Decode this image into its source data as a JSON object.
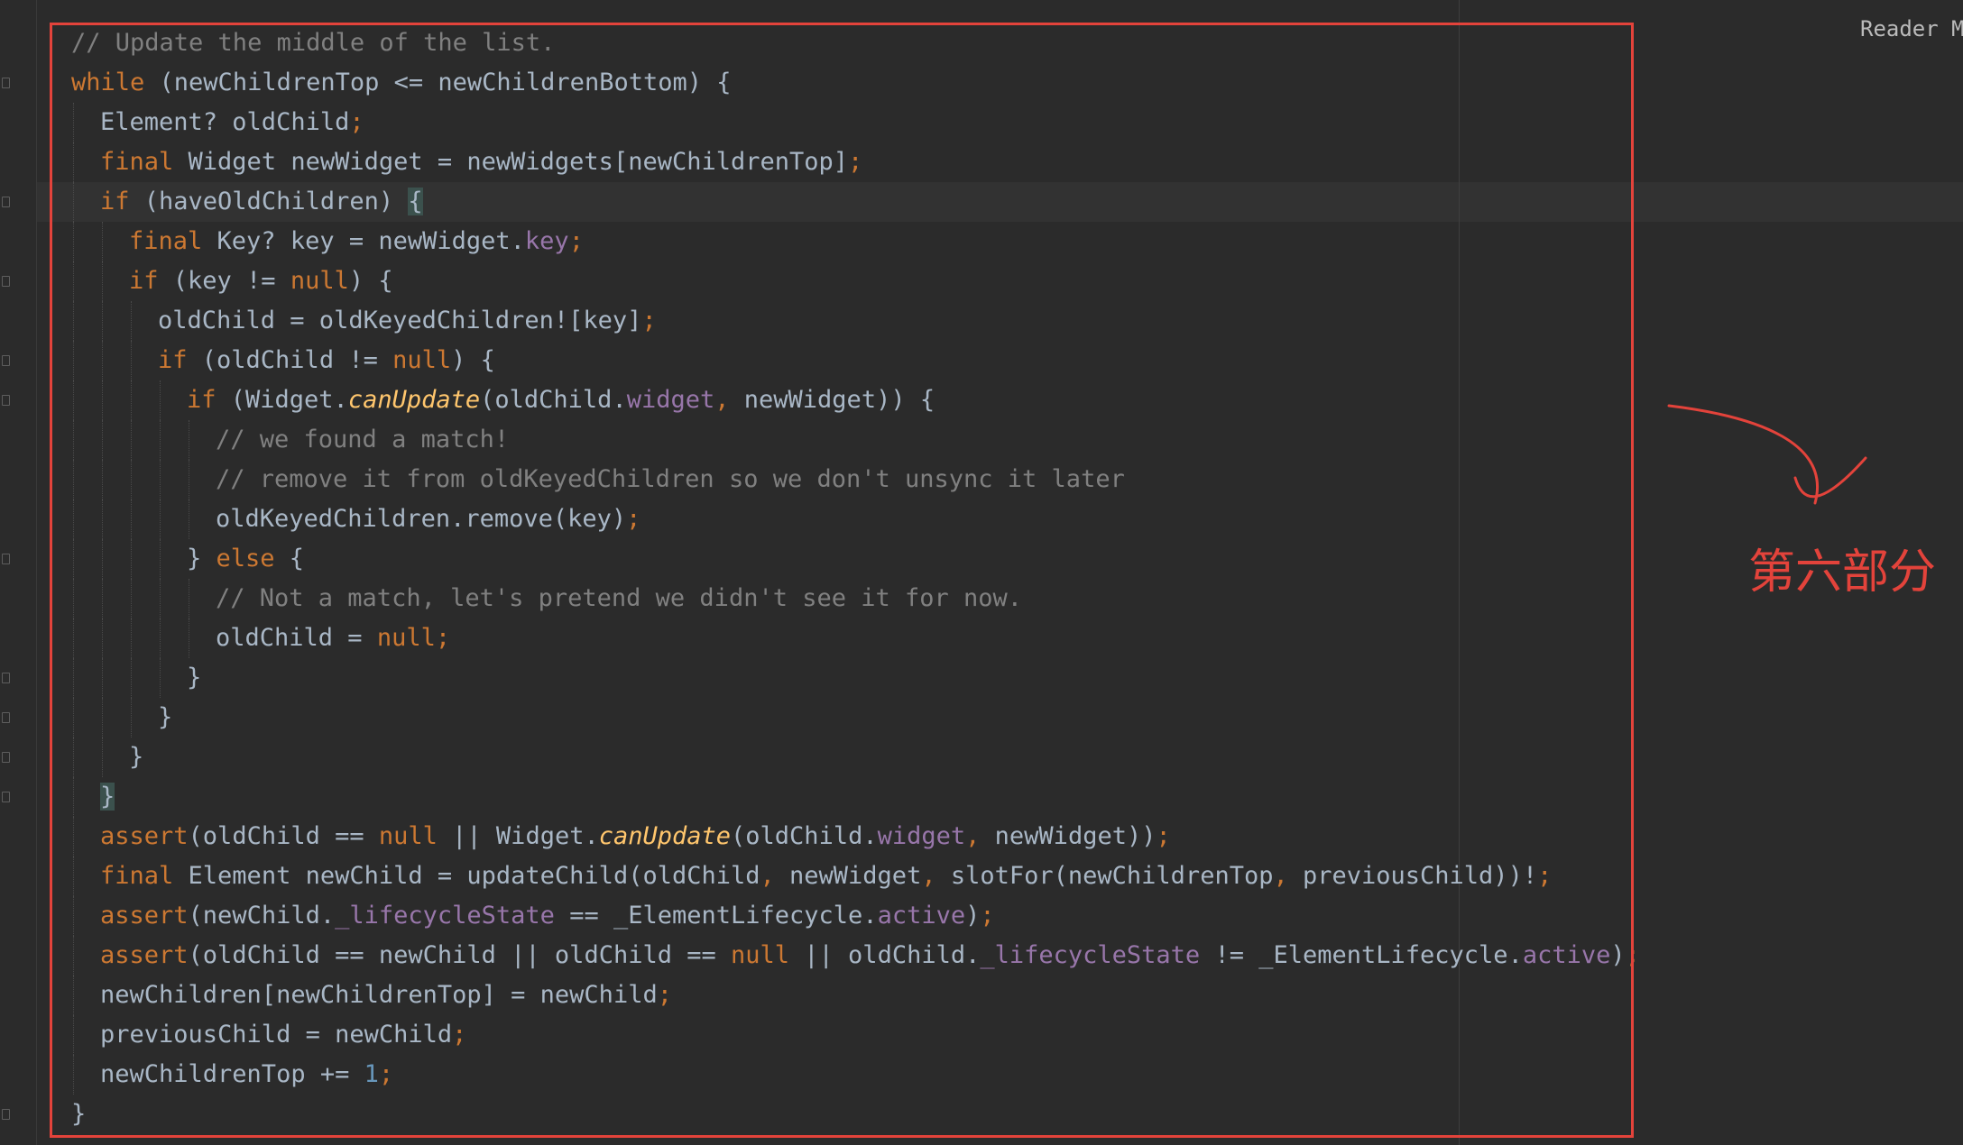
{
  "editor": {
    "reader_mode_label": "Reader M",
    "selection_color": "#e3433b",
    "theme": {
      "background": "#2b2b2b",
      "text": "#a9b7c6",
      "keyword": "#cc7832",
      "number": "#6897bb",
      "comment": "#808080",
      "field": "#9876aa",
      "method": "#ffc66d"
    }
  },
  "annotation": {
    "label": "第六部分",
    "arrow_icon": "curved-arrow-icon"
  },
  "code": {
    "lines": [
      {
        "indent": 0,
        "tokens": [
          {
            "t": "// Update the middle of the list.",
            "c": "cmt"
          }
        ]
      },
      {
        "indent": 0,
        "tokens": [
          {
            "t": "while",
            "c": "kw"
          },
          {
            "t": " (newChildrenTop <= newChildrenBottom) {"
          }
        ]
      },
      {
        "indent": 1,
        "tokens": [
          {
            "t": "Element? oldChild"
          },
          {
            "t": ";",
            "c": "kw"
          }
        ]
      },
      {
        "indent": 1,
        "tokens": [
          {
            "t": "final",
            "c": "kw"
          },
          {
            "t": " Widget newWidget = newWidgets[newChildrenTop]"
          },
          {
            "t": ";",
            "c": "kw"
          }
        ]
      },
      {
        "indent": 1,
        "tokens": [
          {
            "t": "if",
            "c": "kw"
          },
          {
            "t": " (haveOldChildren) "
          },
          {
            "t": "{",
            "c": "brc"
          }
        ]
      },
      {
        "indent": 2,
        "tokens": [
          {
            "t": "final",
            "c": "kw"
          },
          {
            "t": " Key? key = newWidget."
          },
          {
            "t": "key",
            "c": "fld"
          },
          {
            "t": ";",
            "c": "kw"
          }
        ]
      },
      {
        "indent": 2,
        "tokens": [
          {
            "t": "if",
            "c": "kw"
          },
          {
            "t": " (key != "
          },
          {
            "t": "null",
            "c": "kw"
          },
          {
            "t": ") {"
          }
        ]
      },
      {
        "indent": 3,
        "tokens": [
          {
            "t": "oldChild = oldKeyedChildren![key]"
          },
          {
            "t": ";",
            "c": "kw"
          }
        ]
      },
      {
        "indent": 3,
        "tokens": [
          {
            "t": "if",
            "c": "kw"
          },
          {
            "t": " (oldChild != "
          },
          {
            "t": "null",
            "c": "kw"
          },
          {
            "t": ") {"
          }
        ]
      },
      {
        "indent": 4,
        "tokens": [
          {
            "t": "if",
            "c": "kw"
          },
          {
            "t": " (Widget."
          },
          {
            "t": "canUpdate",
            "c": "mth"
          },
          {
            "t": "(oldChild."
          },
          {
            "t": "widget",
            "c": "fld"
          },
          {
            "t": ",",
            "c": "kw"
          },
          {
            "t": " newWidget)) {"
          }
        ]
      },
      {
        "indent": 5,
        "tokens": [
          {
            "t": "// we found a match!",
            "c": "cmt"
          }
        ]
      },
      {
        "indent": 5,
        "tokens": [
          {
            "t": "// remove it from oldKeyedChildren so we don't unsync it later",
            "c": "cmt"
          }
        ]
      },
      {
        "indent": 5,
        "tokens": [
          {
            "t": "oldKeyedChildren.remove(key)"
          },
          {
            "t": ";",
            "c": "kw"
          }
        ]
      },
      {
        "indent": 4,
        "tokens": [
          {
            "t": "} "
          },
          {
            "t": "else",
            "c": "kw"
          },
          {
            "t": " {"
          }
        ]
      },
      {
        "indent": 5,
        "tokens": [
          {
            "t": "// Not a match, let's pretend we didn't see it for now.",
            "c": "cmt"
          }
        ]
      },
      {
        "indent": 5,
        "tokens": [
          {
            "t": "oldChild = "
          },
          {
            "t": "null",
            "c": "kw"
          },
          {
            "t": ";",
            "c": "kw"
          }
        ]
      },
      {
        "indent": 4,
        "tokens": [
          {
            "t": "}"
          }
        ]
      },
      {
        "indent": 3,
        "tokens": [
          {
            "t": "}"
          }
        ]
      },
      {
        "indent": 2,
        "tokens": [
          {
            "t": "}"
          }
        ]
      },
      {
        "indent": 1,
        "tokens": [
          {
            "t": "}",
            "c": "brc"
          }
        ]
      },
      {
        "indent": 1,
        "tokens": [
          {
            "t": "assert",
            "c": "kw"
          },
          {
            "t": "(oldChild == "
          },
          {
            "t": "null",
            "c": "kw"
          },
          {
            "t": " || Widget."
          },
          {
            "t": "canUpdate",
            "c": "mth"
          },
          {
            "t": "(oldChild."
          },
          {
            "t": "widget",
            "c": "fld"
          },
          {
            "t": ",",
            "c": "kw"
          },
          {
            "t": " newWidget))"
          },
          {
            "t": ";",
            "c": "kw"
          }
        ]
      },
      {
        "indent": 1,
        "tokens": [
          {
            "t": "final",
            "c": "kw"
          },
          {
            "t": " Element newChild = updateChild(oldChild"
          },
          {
            "t": ",",
            "c": "kw"
          },
          {
            "t": " newWidget"
          },
          {
            "t": ",",
            "c": "kw"
          },
          {
            "t": " slotFor(newChildrenTop"
          },
          {
            "t": ",",
            "c": "kw"
          },
          {
            "t": " previousChild))!"
          },
          {
            "t": ";",
            "c": "kw"
          }
        ]
      },
      {
        "indent": 1,
        "tokens": [
          {
            "t": "assert",
            "c": "kw"
          },
          {
            "t": "(newChild."
          },
          {
            "t": "_lifecycleState",
            "c": "fld"
          },
          {
            "t": " == _ElementLifecycle."
          },
          {
            "t": "active",
            "c": "fld"
          },
          {
            "t": ")"
          },
          {
            "t": ";",
            "c": "kw"
          }
        ]
      },
      {
        "indent": 1,
        "tokens": [
          {
            "t": "assert",
            "c": "kw"
          },
          {
            "t": "(oldChild == newChild || oldChild == "
          },
          {
            "t": "null",
            "c": "kw"
          },
          {
            "t": " || oldChild."
          },
          {
            "t": "_lifecycleState",
            "c": "fld"
          },
          {
            "t": " != _ElementLifecycle."
          },
          {
            "t": "active",
            "c": "fld"
          },
          {
            "t": ")"
          },
          {
            "t": ";",
            "c": "kw"
          }
        ]
      },
      {
        "indent": 1,
        "tokens": [
          {
            "t": "newChildren[newChildrenTop] = newChild"
          },
          {
            "t": ";",
            "c": "kw"
          }
        ]
      },
      {
        "indent": 1,
        "tokens": [
          {
            "t": "previousChild = newChild"
          },
          {
            "t": ";",
            "c": "kw"
          }
        ]
      },
      {
        "indent": 1,
        "tokens": [
          {
            "t": "newChildrenTop += "
          },
          {
            "t": "1",
            "c": "num"
          },
          {
            "t": ";",
            "c": "kw"
          }
        ]
      },
      {
        "indent": 0,
        "tokens": [
          {
            "t": "}"
          }
        ]
      }
    ]
  }
}
